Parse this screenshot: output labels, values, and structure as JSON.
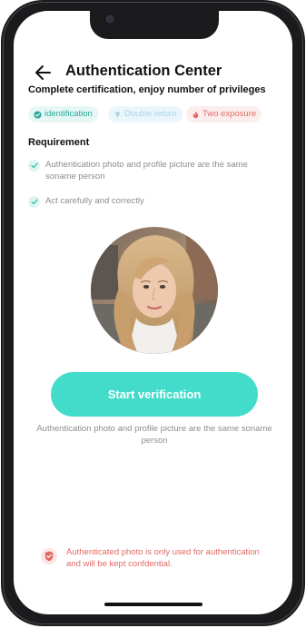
{
  "header": {
    "title": "Authentication Center",
    "subtitle": "Complete certification, enjoy number of privileges"
  },
  "tags": [
    {
      "label": "identification",
      "icon": "check-circle-icon",
      "color": "#2aa89a"
    },
    {
      "label": "Double return",
      "icon": "diamond-icon",
      "color": "#a8d4e6"
    },
    {
      "label": "Two exposure",
      "icon": "flame-icon",
      "color": "#e06a63"
    }
  ],
  "requirements": {
    "heading": "Requirement",
    "items": [
      {
        "text": "Authentication photo and profile picture are the same soname person"
      },
      {
        "text": "Act carefully and correctly"
      }
    ]
  },
  "actions": {
    "start_label": "Start verification",
    "note": "Authentication photo and profile picture are the same soname person"
  },
  "privacy": {
    "text": "Authenticated photo is only used for authentication and will be kept confdential."
  },
  "colors": {
    "accent": "#43dccb",
    "warning": "#e06a63"
  }
}
